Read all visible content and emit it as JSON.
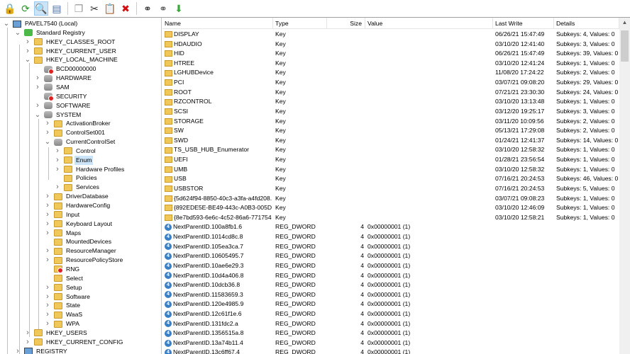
{
  "toolbar": {
    "buttons": [
      {
        "icon": "lock-icon",
        "glyph": "🔒",
        "color": "#e8b400"
      },
      {
        "icon": "refresh-icon",
        "glyph": "⟳",
        "color": "#2a9a2a"
      },
      {
        "icon": "find-folder-icon",
        "glyph": "🔍",
        "color": "#c89a3a",
        "active": true
      },
      {
        "icon": "editor-icon",
        "glyph": "▤",
        "color": "#4a6fa5"
      },
      {
        "sep": true
      },
      {
        "icon": "copy-icon",
        "glyph": "❐",
        "color": "#999"
      },
      {
        "icon": "cut-icon",
        "glyph": "✂",
        "color": "#333"
      },
      {
        "icon": "paste-icon",
        "glyph": "📋",
        "color": "#999"
      },
      {
        "icon": "delete-icon",
        "glyph": "✖",
        "color": "#d01010"
      },
      {
        "sep": true
      },
      {
        "icon": "binoculars-icon",
        "glyph": "⚭",
        "color": "#333"
      },
      {
        "icon": "find-next-icon",
        "glyph": "⚭",
        "color": "#555"
      },
      {
        "icon": "export-icon",
        "glyph": "⬇",
        "color": "#3aa83a"
      }
    ]
  },
  "tree": [
    {
      "label": "PAVEL7540 (Local)",
      "lvl": 0,
      "arrow": "v",
      "icon": "pc"
    },
    {
      "label": "Standard Registry",
      "lvl": 1,
      "arrow": "v",
      "icon": "green"
    },
    {
      "label": "HKEY_CLASSES_ROOT",
      "lvl": 2,
      "arrow": ">",
      "icon": "folder"
    },
    {
      "label": "HKEY_CURRENT_USER",
      "lvl": 2,
      "arrow": ">",
      "icon": "folder"
    },
    {
      "label": "HKEY_LOCAL_MACHINE",
      "lvl": 2,
      "arrow": "v",
      "icon": "folder"
    },
    {
      "label": "BCD00000000",
      "lvl": 3,
      "arrow": "",
      "icon": "db deny"
    },
    {
      "label": "HARDWARE",
      "lvl": 3,
      "arrow": ">",
      "icon": "db"
    },
    {
      "label": "SAM",
      "lvl": 3,
      "arrow": ">",
      "icon": "db"
    },
    {
      "label": "SECURITY",
      "lvl": 3,
      "arrow": "",
      "icon": "db deny"
    },
    {
      "label": "SOFTWARE",
      "lvl": 3,
      "arrow": ">",
      "icon": "db"
    },
    {
      "label": "SYSTEM",
      "lvl": 3,
      "arrow": "v",
      "icon": "db"
    },
    {
      "label": "ActivationBroker",
      "lvl": 4,
      "arrow": ">",
      "icon": "folder"
    },
    {
      "label": "ControlSet001",
      "lvl": 4,
      "arrow": ">",
      "icon": "folder"
    },
    {
      "label": "CurrentControlSet",
      "lvl": 4,
      "arrow": "v",
      "icon": "db"
    },
    {
      "label": "Control",
      "lvl": 5,
      "arrow": ">",
      "icon": "folder"
    },
    {
      "label": "Enum",
      "lvl": 5,
      "arrow": ">",
      "icon": "folder",
      "selected": true
    },
    {
      "label": "Hardware Profiles",
      "lvl": 5,
      "arrow": ">",
      "icon": "folder"
    },
    {
      "label": "Policies",
      "lvl": 5,
      "arrow": "",
      "icon": "folder"
    },
    {
      "label": "Services",
      "lvl": 5,
      "arrow": ">",
      "icon": "folder"
    },
    {
      "label": "DriverDatabase",
      "lvl": 4,
      "arrow": ">",
      "icon": "folder"
    },
    {
      "label": "HardwareConfig",
      "lvl": 4,
      "arrow": ">",
      "icon": "folder"
    },
    {
      "label": "Input",
      "lvl": 4,
      "arrow": ">",
      "icon": "folder"
    },
    {
      "label": "Keyboard Layout",
      "lvl": 4,
      "arrow": ">",
      "icon": "folder"
    },
    {
      "label": "Maps",
      "lvl": 4,
      "arrow": ">",
      "icon": "folder"
    },
    {
      "label": "MountedDevices",
      "lvl": 4,
      "arrow": "",
      "icon": "folder"
    },
    {
      "label": "ResourceManager",
      "lvl": 4,
      "arrow": ">",
      "icon": "folder"
    },
    {
      "label": "ResourcePolicyStore",
      "lvl": 4,
      "arrow": ">",
      "icon": "folder"
    },
    {
      "label": "RNG",
      "lvl": 4,
      "arrow": "",
      "icon": "folder deny"
    },
    {
      "label": "Select",
      "lvl": 4,
      "arrow": "",
      "icon": "folder"
    },
    {
      "label": "Setup",
      "lvl": 4,
      "arrow": ">",
      "icon": "folder"
    },
    {
      "label": "Software",
      "lvl": 4,
      "arrow": ">",
      "icon": "folder"
    },
    {
      "label": "State",
      "lvl": 4,
      "arrow": ">",
      "icon": "folder"
    },
    {
      "label": "WaaS",
      "lvl": 4,
      "arrow": ">",
      "icon": "folder"
    },
    {
      "label": "WPA",
      "lvl": 4,
      "arrow": ">",
      "icon": "folder"
    },
    {
      "label": "HKEY_USERS",
      "lvl": 2,
      "arrow": ">",
      "icon": "folder"
    },
    {
      "label": "HKEY_CURRENT_CONFIG",
      "lvl": 2,
      "arrow": ">",
      "icon": "folder"
    },
    {
      "label": "REGISTRY",
      "lvl": 1,
      "arrow": ">",
      "icon": "pc"
    }
  ],
  "list": {
    "columns": [
      "Name",
      "Type",
      "Size",
      "Value",
      "Last Write",
      "Details"
    ],
    "rows": [
      [
        "DISPLAY",
        "Key",
        "",
        "",
        "06/26/21 15:47:49",
        "Subkeys: 4, Values: 0"
      ],
      [
        "HDAUDIO",
        "Key",
        "",
        "",
        "03/10/20 12:41:40",
        "Subkeys: 3, Values: 0"
      ],
      [
        "HID",
        "Key",
        "",
        "",
        "06/26/21 15:47:49",
        "Subkeys: 39, Values: 0"
      ],
      [
        "HTREE",
        "Key",
        "",
        "",
        "03/10/20 12:41:24",
        "Subkeys: 1, Values: 0"
      ],
      [
        "LGHUBDevice",
        "Key",
        "",
        "",
        "11/08/20 17:24:22",
        "Subkeys: 2, Values: 0"
      ],
      [
        "PCI",
        "Key",
        "",
        "",
        "03/07/21 09:08:20",
        "Subkeys: 29, Values: 0"
      ],
      [
        "ROOT",
        "Key",
        "",
        "",
        "07/21/21 23:30:30",
        "Subkeys: 24, Values: 0"
      ],
      [
        "RZCONTROL",
        "Key",
        "",
        "",
        "03/10/20 13:13:48",
        "Subkeys: 1, Values: 0"
      ],
      [
        "SCSI",
        "Key",
        "",
        "",
        "03/12/20 19:25:17",
        "Subkeys: 3, Values: 0"
      ],
      [
        "STORAGE",
        "Key",
        "",
        "",
        "03/11/20 10:09:56",
        "Subkeys: 2, Values: 0"
      ],
      [
        "SW",
        "Key",
        "",
        "",
        "05/13/21 17:29:08",
        "Subkeys: 2, Values: 0"
      ],
      [
        "SWD",
        "Key",
        "",
        "",
        "01/24/21 12:41:37",
        "Subkeys: 14, Values: 0"
      ],
      [
        "TS_USB_HUB_Enumerator",
        "Key",
        "",
        "",
        "03/10/20 12:58:32",
        "Subkeys: 1, Values: 0"
      ],
      [
        "UEFI",
        "Key",
        "",
        "",
        "01/28/21 23:56:54",
        "Subkeys: 1, Values: 0"
      ],
      [
        "UMB",
        "Key",
        "",
        "",
        "03/10/20 12:58:32",
        "Subkeys: 1, Values: 0"
      ],
      [
        "USB",
        "Key",
        "",
        "",
        "07/16/21 20:24:53",
        "Subkeys: 46, Values: 0"
      ],
      [
        "USBSTOR",
        "Key",
        "",
        "",
        "07/16/21 20:24:53",
        "Subkeys: 5, Values: 0"
      ],
      [
        "{5d624f94-8850-40c3-a3fa-a4fd208...",
        "Key",
        "",
        "",
        "03/07/21 09:08:23",
        "Subkeys: 1, Values: 0"
      ],
      [
        "{892EDE5E-BE49-443c-A0B3-005D7...",
        "Key",
        "",
        "",
        "03/10/20 12:46:09",
        "Subkeys: 1, Values: 0"
      ],
      [
        "{8e7bd593-6e6c-4c52-86a6-771754...",
        "Key",
        "",
        "",
        "03/10/20 12:58:21",
        "Subkeys: 1, Values: 0"
      ],
      [
        "NextParentID.100a8fb1.6",
        "REG_DWORD",
        "4",
        "0x00000001 (1)",
        "",
        ""
      ],
      [
        "NextParentID.1014cd8c.8",
        "REG_DWORD",
        "4",
        "0x00000001 (1)",
        "",
        ""
      ],
      [
        "NextParentID.105ea3ca.7",
        "REG_DWORD",
        "4",
        "0x00000001 (1)",
        "",
        ""
      ],
      [
        "NextParentID.10605495.7",
        "REG_DWORD",
        "4",
        "0x00000001 (1)",
        "",
        ""
      ],
      [
        "NextParentID.10ae6e29.3",
        "REG_DWORD",
        "4",
        "0x00000001 (1)",
        "",
        ""
      ],
      [
        "NextParentID.10d4a406.8",
        "REG_DWORD",
        "4",
        "0x00000001 (1)",
        "",
        ""
      ],
      [
        "NextParentID.10dcb36.8",
        "REG_DWORD",
        "4",
        "0x00000001 (1)",
        "",
        ""
      ],
      [
        "NextParentID.11583659.3",
        "REG_DWORD",
        "4",
        "0x00000001 (1)",
        "",
        ""
      ],
      [
        "NextParentID.120e4985.9",
        "REG_DWORD",
        "4",
        "0x00000001 (1)",
        "",
        ""
      ],
      [
        "NextParentID.12c61f1e.6",
        "REG_DWORD",
        "4",
        "0x00000001 (1)",
        "",
        ""
      ],
      [
        "NextParentID.131fdc2.a",
        "REG_DWORD",
        "4",
        "0x00000001 (1)",
        "",
        ""
      ],
      [
        "NextParentID.1356515a.8",
        "REG_DWORD",
        "4",
        "0x00000001 (1)",
        "",
        ""
      ],
      [
        "NextParentID.13a74b11.4",
        "REG_DWORD",
        "4",
        "0x00000001 (1)",
        "",
        ""
      ],
      [
        "NextParentID.13c6ff67.4",
        "REG_DWORD",
        "4",
        "0x00000001 (1)",
        "",
        ""
      ]
    ],
    "dword_glyph": "4"
  }
}
